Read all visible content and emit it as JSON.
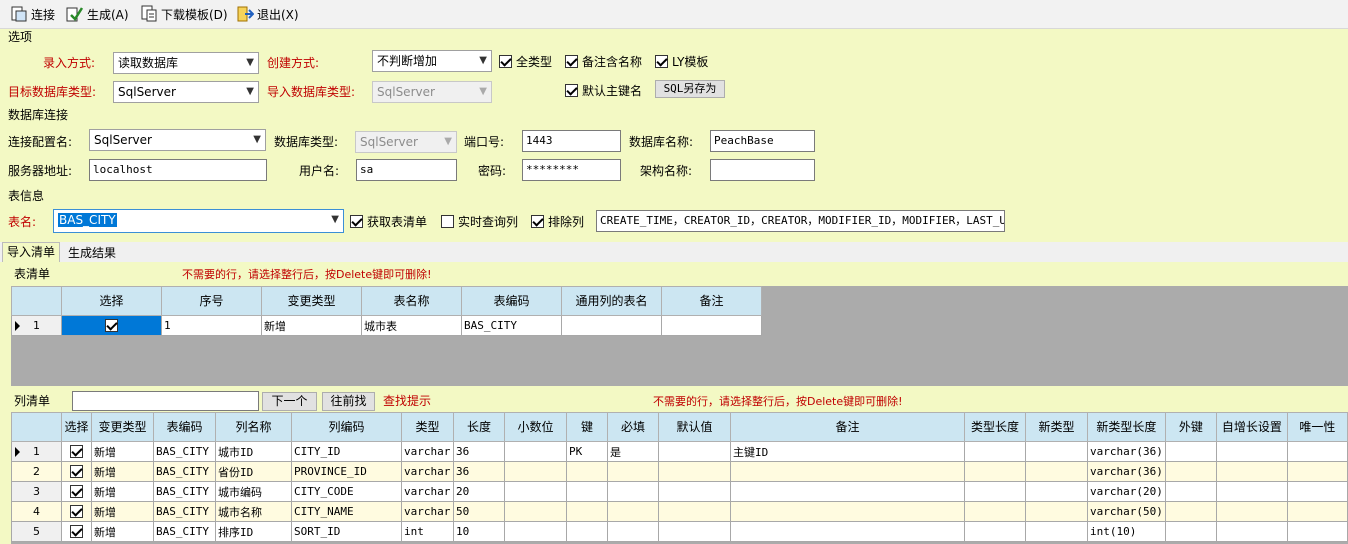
{
  "toolbar": {
    "connect": "连接",
    "generate": "生成(A)",
    "download": "下载模板(D)",
    "exit": "退出(X)"
  },
  "options": {
    "section": "选项",
    "input_mode_label": "录入方式:",
    "input_mode_value": "读取数据库",
    "create_mode_label": "创建方式:",
    "create_mode_value": "不判断增加",
    "all_types": "全类型",
    "remark_name": "备注含名称",
    "ly_template": "LY模板",
    "target_db_label": "目标数据库类型:",
    "target_db_value": "SqlServer",
    "import_db_label": "导入数据库类型:",
    "import_db_value": "SqlServer",
    "default_pk": "默认主键名",
    "sql_save_as": "SQL另存为"
  },
  "dbconn": {
    "section": "数据库连接",
    "config_label": "连接配置名:",
    "config_value": "SqlServer",
    "dbtype_label": "数据库类型:",
    "dbtype_value": "SqlServer",
    "port_label": "端口号:",
    "port_value": "1443",
    "dbname_label": "数据库名称:",
    "dbname_value": "PeachBase",
    "server_label": "服务器地址:",
    "server_value": "localhost",
    "user_label": "用户名:",
    "user_value": "sa",
    "pwd_label": "密码:",
    "pwd_value": "********",
    "schema_label": "架构名称:",
    "schema_value": ""
  },
  "tableinfo": {
    "section": "表信息",
    "table_label": "表名:",
    "table_value": "BAS_CITY",
    "get_list": "获取表清单",
    "realtime": "实时查询列",
    "exclude": "排除列",
    "exclude_value": "CREATE_TIME，CREATOR_ID，CREATOR，MODIFIER_ID，MODIFIER，LAST_UPDAT"
  },
  "tabs": {
    "import": "导入清单",
    "result": "生成结果"
  },
  "table_list": {
    "title": "表清单",
    "hint": "不需要的行，请选择整行后，按Delete键即可删除!",
    "headers": [
      "选择",
      "序号",
      "变更类型",
      "表名称",
      "表编码",
      "通用列的表名",
      "备注"
    ],
    "rows": [
      {
        "num": "1",
        "seq": "1",
        "change": "新增",
        "name": "城市表",
        "code": "BAS_CITY",
        "common": "",
        "remark": ""
      }
    ]
  },
  "column_list": {
    "title": "列清单",
    "search_value": "",
    "next": "下一个",
    "prev": "往前找",
    "find_hint": "查找提示",
    "hint": "不需要的行，请选择整行后，按Delete键即可删除!",
    "headers": [
      "选择",
      "变更类型",
      "表编码",
      "列名称",
      "列编码",
      "类型",
      "长度",
      "小数位",
      "键",
      "必填",
      "默认值",
      "备注",
      "类型长度",
      "新类型",
      "新类型长度",
      "外键",
      "自增长设置",
      "唯一性"
    ],
    "rows": [
      {
        "num": "1",
        "change": "新增",
        "tcode": "BAS_CITY",
        "cname": "城市ID",
        "ccode": "CITY_ID",
        "type": "varchar",
        "len": "36",
        "dec": "",
        "key": "PK",
        "req": "是",
        "def": "",
        "remark": "主键ID",
        "tlen": "",
        "ntype": "",
        "ntlen": "varchar(36)",
        "fk": "",
        "inc": "",
        "uniq": ""
      },
      {
        "num": "2",
        "change": "新增",
        "tcode": "BAS_CITY",
        "cname": "省份ID",
        "ccode": "PROVINCE_ID",
        "type": "varchar",
        "len": "36",
        "dec": "",
        "key": "",
        "req": "",
        "def": "",
        "remark": "",
        "tlen": "",
        "ntype": "",
        "ntlen": "varchar(36)",
        "fk": "",
        "inc": "",
        "uniq": ""
      },
      {
        "num": "3",
        "change": "新增",
        "tcode": "BAS_CITY",
        "cname": "城市编码",
        "ccode": "CITY_CODE",
        "type": "varchar",
        "len": "20",
        "dec": "",
        "key": "",
        "req": "",
        "def": "",
        "remark": "",
        "tlen": "",
        "ntype": "",
        "ntlen": "varchar(20)",
        "fk": "",
        "inc": "",
        "uniq": ""
      },
      {
        "num": "4",
        "change": "新增",
        "tcode": "BAS_CITY",
        "cname": "城市名称",
        "ccode": "CITY_NAME",
        "type": "varchar",
        "len": "50",
        "dec": "",
        "key": "",
        "req": "",
        "def": "",
        "remark": "",
        "tlen": "",
        "ntype": "",
        "ntlen": "varchar(50)",
        "fk": "",
        "inc": "",
        "uniq": ""
      },
      {
        "num": "5",
        "change": "新增",
        "tcode": "BAS_CITY",
        "cname": "排序ID",
        "ccode": "SORT_ID",
        "type": "int",
        "len": "10",
        "dec": "",
        "key": "",
        "req": "",
        "def": "",
        "remark": "",
        "tlen": "",
        "ntype": "",
        "ntlen": "int(10)",
        "fk": "",
        "inc": "",
        "uniq": ""
      }
    ]
  }
}
